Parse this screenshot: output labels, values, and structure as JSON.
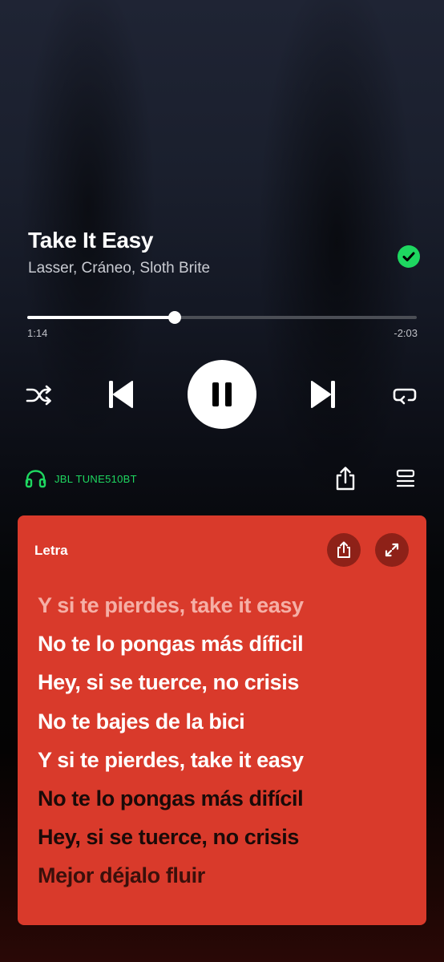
{
  "track": {
    "title": "Take It Easy",
    "artists": "Lasser, Cráneo, Sloth Brite",
    "liked": true
  },
  "playback": {
    "elapsed": "1:14",
    "remaining": "-2:03",
    "progress_fraction": 0.378,
    "state": "playing"
  },
  "controls": {
    "shuffle_icon": "shuffle-icon",
    "previous_icon": "skip-previous-icon",
    "play_pause_icon": "pause-icon",
    "next_icon": "skip-next-icon",
    "repeat_icon": "repeat-icon"
  },
  "device": {
    "name": "JBL TUNE510BT",
    "icon": "headphones-icon"
  },
  "lyrics": {
    "header": "Letra",
    "lines": [
      "Y si te pierdes, take it easy",
      "No te lo pongas más díficil",
      "Hey, si se tuerce, no crisis",
      "No te bajes de la bici",
      "Y si te pierdes, take it easy",
      "No te lo pongas más difícil",
      "Hey, si se tuerce, no crisis",
      "Mejor déjalo fluir"
    ]
  },
  "colors": {
    "accent": "#1ed760",
    "lyrics_card": "#d93a2b",
    "lyrics_button": "#8e2118"
  }
}
